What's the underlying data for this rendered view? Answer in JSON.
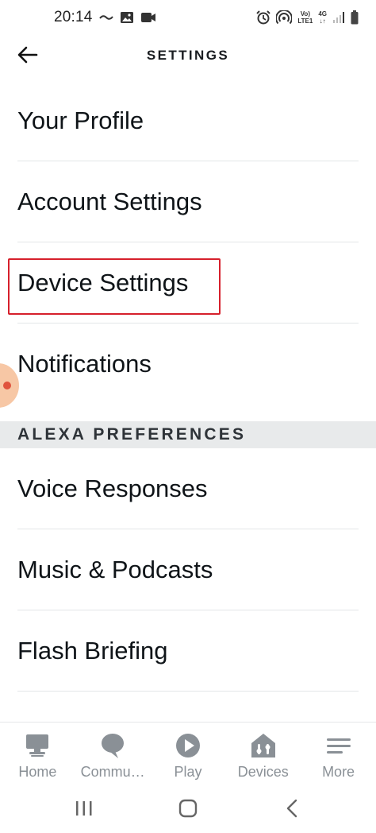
{
  "status_bar": {
    "time": "20:14",
    "net_line1": "Vo)",
    "net_line2": "LTE1",
    "net_4g": "4G"
  },
  "header": {
    "title": "SETTINGS"
  },
  "menu": {
    "items": [
      {
        "label": "Your Profile"
      },
      {
        "label": "Account Settings"
      },
      {
        "label": "Device Settings"
      },
      {
        "label": "Notifications"
      }
    ],
    "section_alexa": "ALEXA PREFERENCES",
    "alexa_items": [
      {
        "label": "Voice Responses"
      },
      {
        "label": "Music & Podcasts"
      },
      {
        "label": "Flash Briefing"
      }
    ]
  },
  "bottom_nav": {
    "items": [
      {
        "label": "Home",
        "icon": "home-icon"
      },
      {
        "label": "Commu…",
        "icon": "communicate-icon"
      },
      {
        "label": "Play",
        "icon": "play-icon"
      },
      {
        "label": "Devices",
        "icon": "devices-icon"
      },
      {
        "label": "More",
        "icon": "more-icon"
      }
    ]
  },
  "colors": {
    "highlight": "#d6202c",
    "nav_icon": "#8a9096",
    "section_bg": "#e8eaeb"
  }
}
